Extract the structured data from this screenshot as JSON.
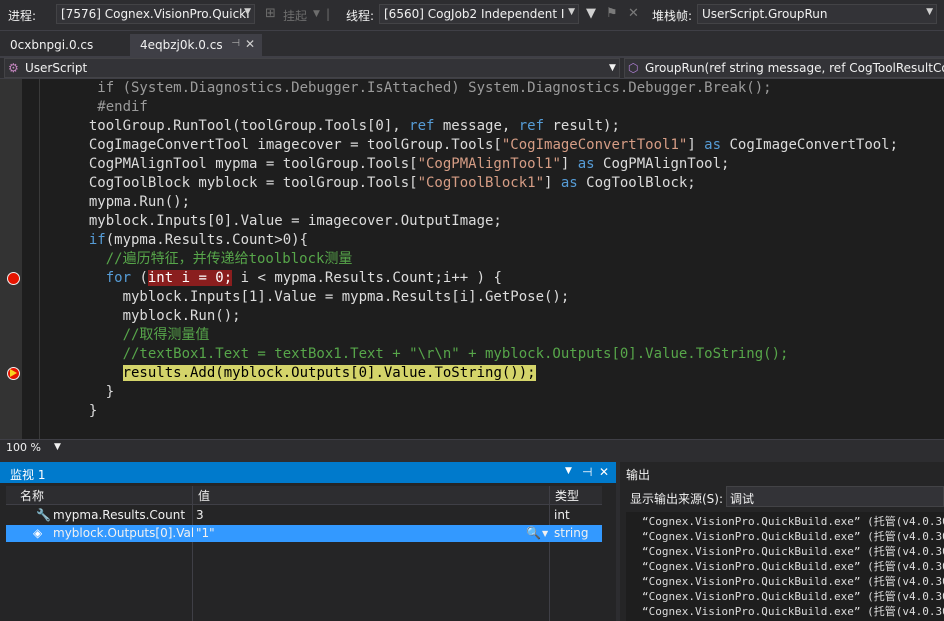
{
  "toolbar": {
    "process_label": "进程:",
    "process_value": "[7576] Cognex.VisionPro.QuickI",
    "suspend_label": "挂起",
    "thread_label": "线程:",
    "thread_value": "[6560] CogJob2 Independent I",
    "stackframe_label": "堆栈帧:",
    "stackframe_value": "UserScript.GroupRun"
  },
  "tabs": [
    {
      "label": "0cxbnpgi.0.cs",
      "active": false
    },
    {
      "label": "4eqbzj0k.0.cs",
      "active": true
    }
  ],
  "navbar": {
    "class_name": "UserScript",
    "method_name": "GroupRun(ref string message, ref CogToolResultCo"
  },
  "editor": {
    "lines": [
      {
        "indent": 0,
        "kind": "dim",
        "segments": [
          {
            "t": "   if (System.Diagnostics.Debugger.IsAttached) System.Diagnostics.Debugger.Break();",
            "c": "dim"
          }
        ]
      },
      {
        "indent": 0,
        "kind": "dim",
        "segments": [
          {
            "t": "   #endif",
            "c": "dim"
          }
        ]
      },
      {
        "segments": [
          {
            "t": "  toolGroup.RunTool(toolGroup.Tools[0], ",
            "c": ""
          },
          {
            "t": "ref",
            "c": "kw"
          },
          {
            "t": " message, ",
            "c": ""
          },
          {
            "t": "ref",
            "c": "kw"
          },
          {
            "t": " result);",
            "c": ""
          }
        ]
      },
      {
        "segments": [
          {
            "t": "  CogImageConvertTool imagecover = toolGroup.Tools[",
            "c": ""
          },
          {
            "t": "\"CogImageConvertTool1\"",
            "c": "str"
          },
          {
            "t": "] ",
            "c": ""
          },
          {
            "t": "as",
            "c": "kw"
          },
          {
            "t": " CogImageConvertTool;",
            "c": ""
          }
        ]
      },
      {
        "segments": [
          {
            "t": "  CogPMAlignTool mypma = toolGroup.Tools[",
            "c": ""
          },
          {
            "t": "\"CogPMAlignTool1\"",
            "c": "str"
          },
          {
            "t": "] ",
            "c": ""
          },
          {
            "t": "as",
            "c": "kw"
          },
          {
            "t": " CogPMAlignTool;",
            "c": ""
          }
        ]
      },
      {
        "segments": [
          {
            "t": "  CogToolBlock myblock = toolGroup.Tools[",
            "c": ""
          },
          {
            "t": "\"CogToolBlock1\"",
            "c": "str"
          },
          {
            "t": "] ",
            "c": ""
          },
          {
            "t": "as",
            "c": "kw"
          },
          {
            "t": " CogToolBlock;",
            "c": ""
          }
        ]
      },
      {
        "segments": [
          {
            "t": "  mypma.Run();",
            "c": ""
          }
        ]
      },
      {
        "segments": [
          {
            "t": "  myblock.Inputs[0].Value = imagecover.OutputImage;",
            "c": ""
          }
        ]
      },
      {
        "segments": [
          {
            "t": "  ",
            "c": ""
          },
          {
            "t": "if",
            "c": "kw"
          },
          {
            "t": "(mypma.Results.Count>0){",
            "c": ""
          }
        ]
      },
      {
        "segments": [
          {
            "t": "    //遍历特征，并传递给toolblock测量",
            "c": "cmt"
          }
        ]
      },
      {
        "bp": true,
        "segments": [
          {
            "t": "    ",
            "c": ""
          },
          {
            "t": "for",
            "c": "kw"
          },
          {
            "t": " (",
            "c": ""
          },
          {
            "t": "int i = 0;",
            "c": "bpbox"
          },
          {
            "t": " i < mypma.Results.Count;i++ ) {",
            "c": ""
          }
        ]
      },
      {
        "segments": [
          {
            "t": "      myblock.Inputs[1].Value = mypma.Results[i].GetPose();",
            "c": ""
          }
        ]
      },
      {
        "segments": [
          {
            "t": "      myblock.Run();",
            "c": ""
          }
        ]
      },
      {
        "segments": [
          {
            "t": "      //取得测量值",
            "c": "cmt"
          }
        ]
      },
      {
        "segments": [
          {
            "t": "      //textBox1.Text = textBox1.Text + \"\\r\\n\" + myblock.Outputs[0].Value.ToString();",
            "c": "cmt"
          }
        ]
      },
      {
        "current": true,
        "segments": [
          {
            "t": "      ",
            "c": ""
          },
          {
            "t": "results.Add(",
            "c": "curstmt"
          },
          {
            "t": "myblock.Outputs[0].Value.ToString()",
            "c": "curinner"
          },
          {
            "t": ");",
            "c": "curstmt"
          }
        ]
      },
      {
        "segments": [
          {
            "t": "    }",
            "c": ""
          }
        ]
      },
      {
        "segments": [
          {
            "t": "  }",
            "c": ""
          }
        ]
      }
    ]
  },
  "zoom": "100 %",
  "watch": {
    "title": "监视 1",
    "columns": [
      "名称",
      "值",
      "类型"
    ],
    "rows": [
      {
        "name": "mypma.Results.Count",
        "value": "3",
        "type": "int",
        "selected": false,
        "icon": "wrench-icon"
      },
      {
        "name": "myblock.Outputs[0].Value",
        "value": "\"1\"",
        "type": "string",
        "selected": true,
        "icon": "object-icon"
      }
    ]
  },
  "output": {
    "title": "输出",
    "source_label": "显示输出来源(S):",
    "source_value": "调试",
    "lines": [
      "“Cognex.VisionPro.QuickBuild.exe” (托管(v4.0.30319)",
      "“Cognex.VisionPro.QuickBuild.exe” (托管(v4.0.30319)",
      "“Cognex.VisionPro.QuickBuild.exe” (托管(v4.0.30319)",
      "“Cognex.VisionPro.QuickBuild.exe” (托管(v4.0.30319)",
      "“Cognex.VisionPro.QuickBuild.exe” (托管(v4.0.30319)",
      "“Cognex.VisionPro.QuickBuild.exe” (托管(v4.0.30319)",
      "“Cognex.VisionPro.QuickBuild.exe” (托管(v4.0.30319)",
      "“Cognex.VisionPro.QuickBuild.exe” (托管(v4.0.30319)"
    ]
  },
  "colors": {
    "accent": "#007acc",
    "selection": "#3399ff",
    "breakpoint": "#e51400",
    "keyword": "#569cd6",
    "string": "#d69d85",
    "comment": "#57a64a"
  }
}
